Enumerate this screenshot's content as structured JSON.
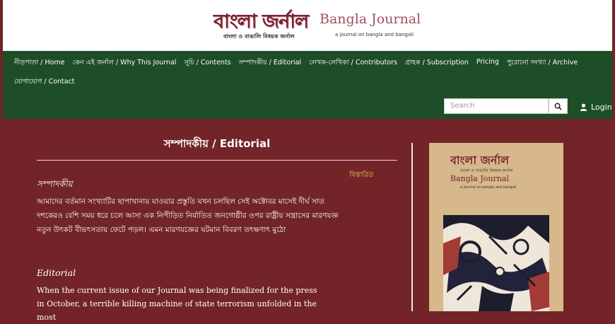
{
  "header": {
    "logo_bn": "বাংলা জর্নাল",
    "logo_bn_sub": "বাংলা ও বাঙালি বিষয়ক জর্নাল",
    "logo_en": "Bangla Journal",
    "logo_en_sub": "a journal on bangla and bangali"
  },
  "nav": {
    "items_row1": [
      "নীড়পাতা / Home",
      "কেন এই জর্নাল / Why This Journal",
      "সূচি / Contents",
      "সম্পাদকীয় / Editorial",
      "লেখক-লেখিকা / Contributors",
      "গ্রাহক / Subscription",
      "Pricing",
      "পুরোনো সংখ্যা / Archive"
    ],
    "items_row2": [
      "যোগাযোগ / Contact"
    ],
    "search_placeholder": "Search",
    "login_label": "Login"
  },
  "main": {
    "title": "সম্পাদকীয় / Editorial",
    "read_more": "বিস্তারিত",
    "bn_heading": "সম্পাদকীয়",
    "bn_paragraph": "আমাদের বর্তমান সংখ্যাটির ছাপাখানায় যাওয়ার প্রস্তুতি যখন চলছিল সেই অক্টোবর মাসেই দীর্ঘ সাত দশকেরও বেশি সময় ধরে চলে আসা এক নিপীড়িত নির্যাতিত জনগোষ্ঠীর ওপর রাষ্ট্রীয় সন্ত্রাসের মারণযজ্ঞ নতুন উৎকট বীভৎসতায় ফেটে পড়ল। এমন মারণযজ্ঞের ঘটমান বিবরণ তৎক্ষণাৎ মুঠো",
    "en_heading": "Editorial",
    "en_paragraph": "When the current issue of our Journal was being finalized for the press in October, a terrible killing machine of state terrorism unfolded in the most"
  },
  "cover": {
    "title_bn": "বাংলা জর্নাল",
    "subtitle_bn": "বাংলা ও বাঙালি বিষয়ক জর্নাল",
    "title_en": "Bangla Journal",
    "subtitle_en": "a journal on bangla and bangali"
  },
  "colors": {
    "background": "#722429",
    "nav": "#1d4e27",
    "header": "#ffffff",
    "accent_link": "#f0c84a",
    "cover": "#d6b88a"
  }
}
